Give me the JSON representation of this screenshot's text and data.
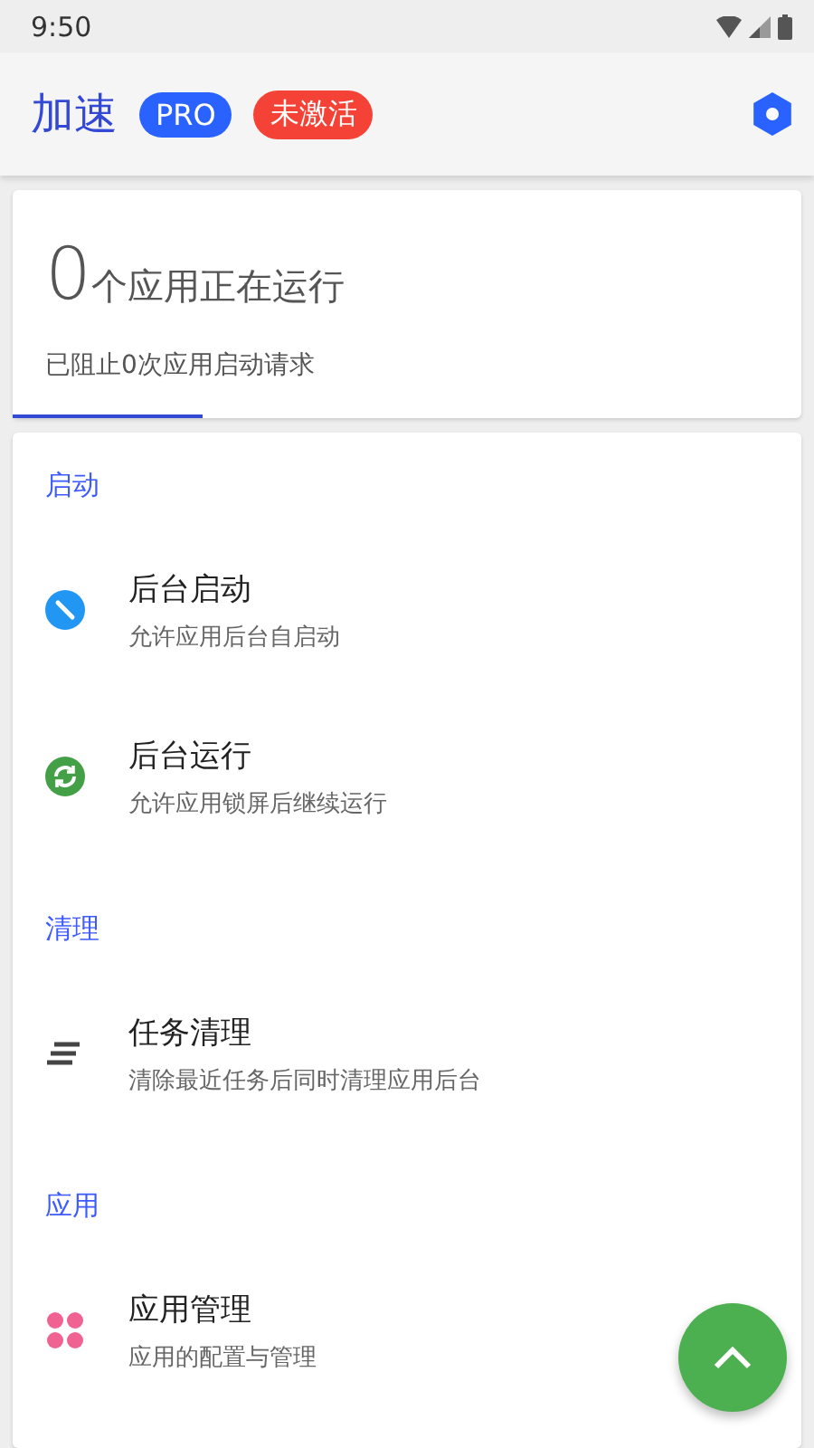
{
  "status_bar": {
    "time": "9:50"
  },
  "app_bar": {
    "title": "加速",
    "badges": [
      {
        "label": "PRO",
        "color": "#2962ff"
      },
      {
        "label": "未激活",
        "color": "#f44336"
      }
    ]
  },
  "summary": {
    "count": "0",
    "count_label": "个应用正在运行",
    "blocked": "已阻止0次应用启动请求"
  },
  "sections": [
    {
      "title": "启动",
      "items": [
        {
          "kind": "block",
          "title": "后台启动",
          "subtitle": "允许应用后台自启动"
        },
        {
          "kind": "sync",
          "title": "后台运行",
          "subtitle": "允许应用锁屏后继续运行"
        }
      ]
    },
    {
      "title": "清理",
      "items": [
        {
          "kind": "clean",
          "title": "任务清理",
          "subtitle": "清除最近任务后同时清理应用后台"
        }
      ]
    },
    {
      "title": "应用",
      "items": [
        {
          "kind": "apps",
          "title": "应用管理",
          "subtitle": "应用的配置与管理"
        }
      ]
    }
  ]
}
